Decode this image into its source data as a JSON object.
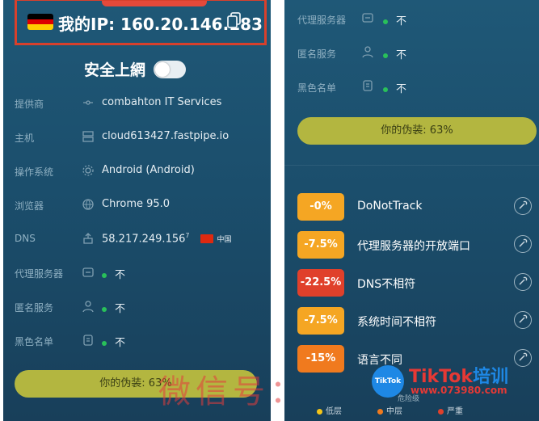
{
  "left": {
    "ip_label": "我的IP: 160.20.146.183",
    "safe_surf_label": "安全上網",
    "safe_surf_on": false,
    "rows": [
      {
        "label": "提供商",
        "value": "combahton IT Services",
        "icon": "network-icon"
      },
      {
        "label": "主机",
        "value": "cloud613427.fastpipe.io",
        "icon": "server-icon"
      },
      {
        "label": "操作系统",
        "value": "Android (Android)",
        "icon": "gear-icon"
      },
      {
        "label": "浏览器",
        "value": "Chrome 95.0",
        "icon": "globe-icon"
      },
      {
        "label": "DNS",
        "value": "58.217.249.156",
        "sup": "7",
        "country": "中国",
        "icon": "dns-icon"
      },
      {
        "label": "代理服务器",
        "value": "不",
        "icon": "proxy-icon"
      },
      {
        "label": "匿名服务",
        "value": "不",
        "icon": "user-icon"
      },
      {
        "label": "黑色名单",
        "value": "不",
        "icon": "blacklist-icon"
      }
    ],
    "disguise": "你的伪装: 63%"
  },
  "right": {
    "rows": [
      {
        "label": "代理服务器",
        "value": "不",
        "icon": "proxy-icon"
      },
      {
        "label": "匿名服务",
        "value": "不",
        "icon": "user-icon"
      },
      {
        "label": "黑色名单",
        "value": "不",
        "icon": "blacklist-icon"
      }
    ],
    "disguise": "你的伪装: 63%",
    "factors": [
      {
        "badge": "-0%",
        "text": "DoNotTrack",
        "color": "#f5a623"
      },
      {
        "badge": "-7.5%",
        "text": "代理服务器的开放端口",
        "color": "#f5a623"
      },
      {
        "badge": "-22.5%",
        "text": "DNS不相符",
        "color": "#e0402b"
      },
      {
        "badge": "-7.5%",
        "text": "系统时间不相符",
        "color": "#f5a623"
      },
      {
        "badge": "-15%",
        "text": "语言不同",
        "color": "#f07a1e"
      }
    ],
    "danger_level": "危险级",
    "legend": [
      {
        "label": "低层",
        "color": "#f5c518"
      },
      {
        "label": "中层",
        "color": "#f07a1e"
      },
      {
        "label": "严重",
        "color": "#e0402b"
      }
    ]
  },
  "watermark": "微信号：",
  "brand": {
    "name": "TikTok",
    "sub": "培训",
    "url": "www.073980.com",
    "logo_text": "TikTok"
  }
}
